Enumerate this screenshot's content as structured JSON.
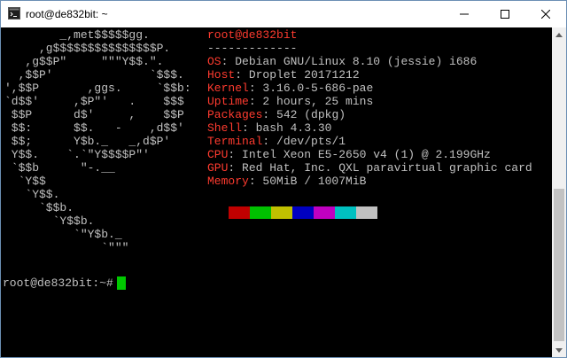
{
  "window": {
    "title": "root@de832bit: ~",
    "app_icon": "terminal-icon",
    "controls": [
      "minimize-icon",
      "maximize-icon",
      "close-icon"
    ]
  },
  "terminal": {
    "ascii_logo": [
      "        _,met$$$$$gg.",
      "     ,g$$$$$$$$$$$$$$$P.",
      "   ,g$$P\"     \"\"\"Y$$.\".",
      "  ,$$P'              `$$$.",
      "',$$P       ,ggs.     `$$b:",
      "`d$$'     ,$P\"'   .    $$$",
      " $$P      d$'     ,    $$P",
      " $$:      $$.   -    ,d$$'",
      " $$;      Y$b._   _,d$P'",
      " Y$$.    `.`\"Y$$$$P\"'",
      " `$$b      \"-.__",
      "  `Y$$",
      "   `Y$$.",
      "     `$$b.",
      "       `Y$$b.",
      "          `\"Y$b._",
      "              `\"\"\""
    ],
    "user_host": "root@de832bit",
    "separator": "-------------",
    "info": [
      {
        "label": "OS",
        "value": "Debian GNU/Linux 8.10 (jessie) i686"
      },
      {
        "label": "Host",
        "value": "Droplet 20171212"
      },
      {
        "label": "Kernel",
        "value": "3.16.0-5-686-pae"
      },
      {
        "label": "Uptime",
        "value": "2 hours, 25 mins"
      },
      {
        "label": "Packages",
        "value": "542 (dpkg)"
      },
      {
        "label": "Shell",
        "value": "bash 4.3.30"
      },
      {
        "label": "Terminal",
        "value": "/dev/pts/1"
      },
      {
        "label": "CPU",
        "value": "Intel Xeon E5-2650 v4 (1) @ 2.199GHz"
      },
      {
        "label": "GPU",
        "value": "Red Hat, Inc. QXL paravirtual graphic card"
      },
      {
        "label": "Memory",
        "value": "50MiB / 1007MiB"
      }
    ],
    "palette": [
      "#c00000",
      "#00c000",
      "#c0c000",
      "#0000c0",
      "#c000c0",
      "#00c0c0",
      "#c0c0c0"
    ],
    "prompt": "root@de832bit:~#",
    "cursor_color": "#00c800",
    "label_color": "#ff3b2f",
    "text_color": "#c0c0c0"
  }
}
